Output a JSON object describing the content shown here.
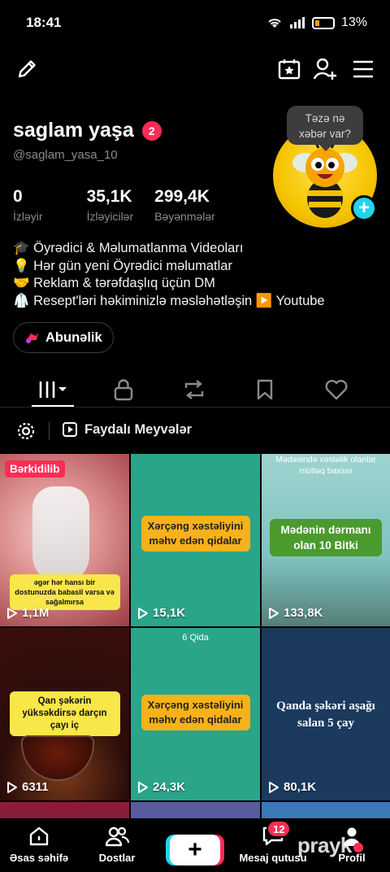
{
  "status_bar": {
    "time": "18:41",
    "battery": "13%"
  },
  "profile": {
    "display_name": "saglam yaşa",
    "name_badge": "2",
    "handle": "@saglam_yasa_10",
    "stats": [
      {
        "value": "0",
        "label": "İzləyir"
      },
      {
        "value": "35,1K",
        "label": "İzləyicilər"
      },
      {
        "value": "299,4K",
        "label": "Bəyənmələr"
      }
    ],
    "avatar_bubble": [
      "Təzə nə",
      "xəbər var?"
    ],
    "bio": [
      "🎓 Öyrədici & Məlumatlanma Videoları",
      "💡 Hər gün yeni Öyrədici məlumatlar",
      "🤝 Reklam & tərəfdaşlıq üçün DM",
      "🥼 Resept'ləri həkiminizlə məsləhətləşin ▶️ Youtube"
    ],
    "subscribe_label": "Abunəlik"
  },
  "playlist": {
    "name": "Faydalı Meyvələr"
  },
  "videos": [
    {
      "views": "1,1M",
      "pinned_label": "Bərkidilib",
      "caption": "əgər hər hansı bir dostunuzda babasil varsa və sağalmırsa"
    },
    {
      "views": "15,1K",
      "caption": "Xərçəng xəstəliyini məhv edən qidalar"
    },
    {
      "views": "133,8K",
      "top_text": "Mədəsində xəstəlik olanlar mütləq baxsın",
      "caption": "Mədənin dərmanı olan 10 Bitki"
    },
    {
      "views": "6311",
      "caption": "Qan şəkərin yüksəkdirsə darçın çayı iç"
    },
    {
      "views": "24,3K",
      "top_text": "6 Qida",
      "caption": "Xərçəng xəstəliyini məhv edən qidalar"
    },
    {
      "views": "80,1K",
      "caption": "Qanda şəkəri aşağı salan 5 çay"
    }
  ],
  "bottom_nav": {
    "home": "Əsas səhifə",
    "friends": "Dostlar",
    "inbox": "Mesaj qutusu",
    "inbox_badge": "12",
    "profile": "Profil"
  },
  "watermark": "prayk",
  "colors": {
    "accent_red": "#fe2c55",
    "accent_cyan": "#20d5ec"
  }
}
